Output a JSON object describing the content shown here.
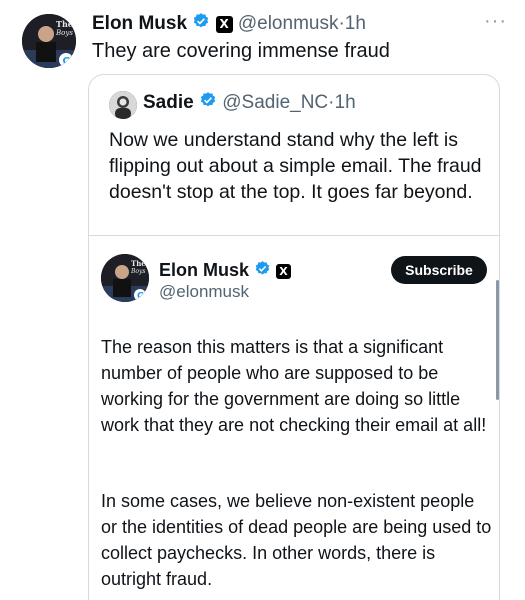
{
  "outer_tweet": {
    "author_name": "Elon Musk",
    "handle": "@elonmusk",
    "separator": "·",
    "time": "1h",
    "more_glyph": "···",
    "text": "They are covering immense fraud",
    "avatar_text": "The Boys",
    "avatar_badge": "C"
  },
  "quoted_tweet": {
    "author_name": "Sadie",
    "handle": "@Sadie_NC",
    "separator": "·",
    "time": "1h",
    "text": "Now we understand stand why the left is flipping out about a simple email. The fraud doesn't stop at the top. It goes far beyond."
  },
  "nested_post": {
    "author_name": "Elon Musk",
    "handle": "@elonmusk",
    "subscribe_label": "Subscribe",
    "avatar_badge": "C",
    "paragraph_1": "The reason this matters is that a significant number of people who are supposed to be working for the government are doing so little work that they are not checking their email at all!",
    "paragraph_2": "In some cases, we believe non-existent people or the identities of dead people are being used to collect paychecks. In other words, there is outright fraud."
  },
  "colors": {
    "verified_blue": "#1d9bf0",
    "secondary_text": "#536471",
    "border": "#d5dbe0"
  }
}
